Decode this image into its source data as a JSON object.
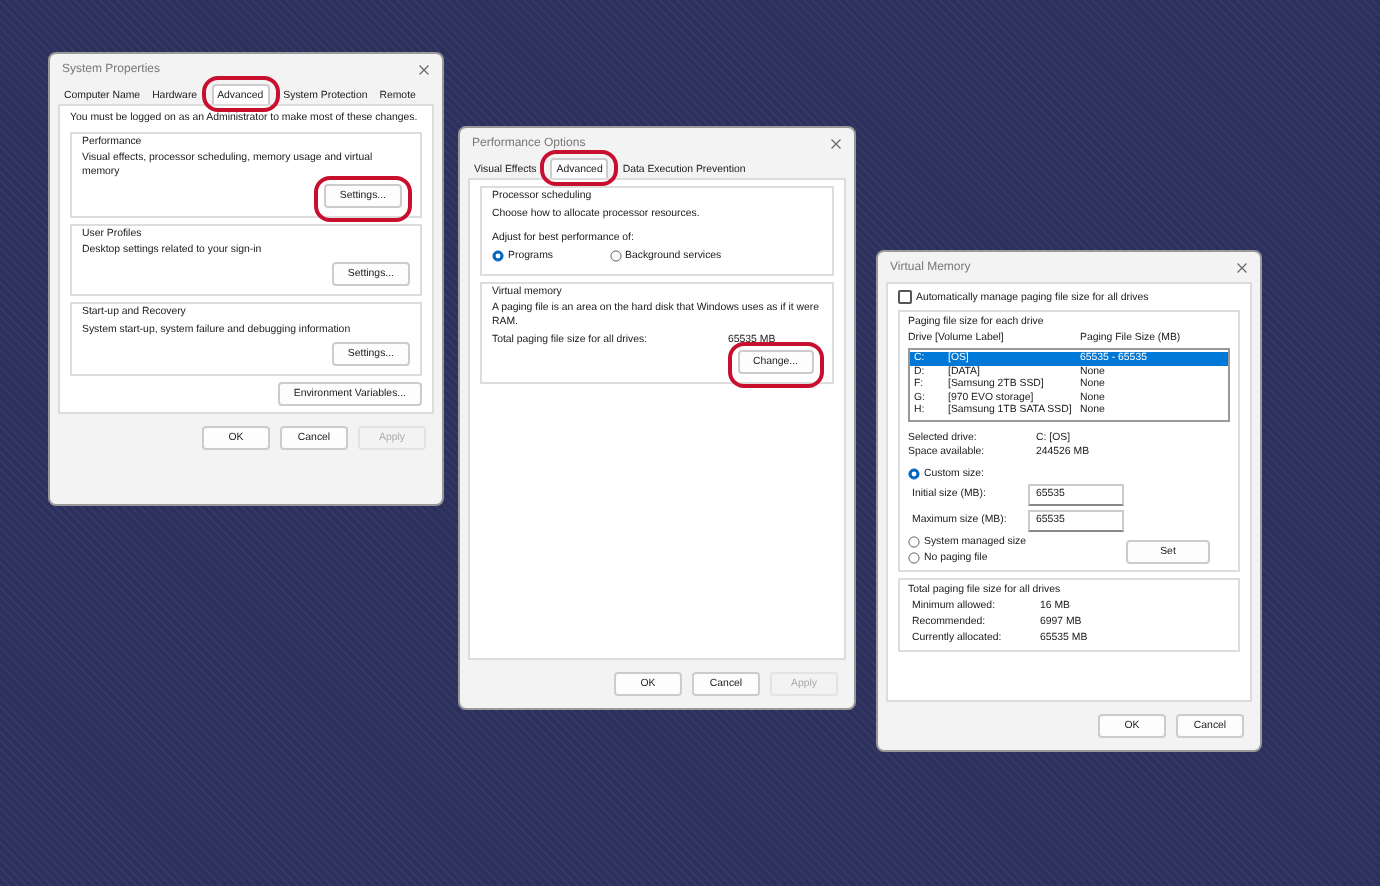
{
  "system_properties": {
    "title": "System Properties",
    "tabs": [
      {
        "label": "Computer Name",
        "selected": false,
        "highlighted": false
      },
      {
        "label": "Hardware",
        "selected": false,
        "highlighted": false
      },
      {
        "label": "Advanced",
        "selected": true,
        "highlighted": true
      },
      {
        "label": "System Protection",
        "selected": false,
        "highlighted": false
      },
      {
        "label": "Remote",
        "selected": false,
        "highlighted": false
      }
    ],
    "notice": "You must be logged on as an Administrator to make most of these changes.",
    "groups": [
      {
        "title": "Performance",
        "description": "Visual effects, processor scheduling, memory usage and virtual memory",
        "button": "Settings...",
        "button_highlighted": true
      },
      {
        "title": "User Profiles",
        "description": "Desktop settings related to your sign-in",
        "button": "Settings...",
        "button_highlighted": false
      },
      {
        "title": "Start-up and Recovery",
        "description": "System start-up, system failure and debugging information",
        "button": "Settings...",
        "button_highlighted": false
      }
    ],
    "env_button": "Environment Variables...",
    "buttons": [
      {
        "label": "OK",
        "disabled": false
      },
      {
        "label": "Cancel",
        "disabled": false
      },
      {
        "label": "Apply",
        "disabled": true
      }
    ]
  },
  "performance_options": {
    "title": "Performance Options",
    "tabs": [
      {
        "label": "Visual Effects",
        "selected": false,
        "highlighted": false
      },
      {
        "label": "Advanced",
        "selected": true,
        "highlighted": true
      },
      {
        "label": "Data Execution Prevention",
        "selected": false,
        "highlighted": false
      }
    ],
    "processor_scheduling": {
      "title": "Processor scheduling",
      "description": "Choose how to allocate processor resources.",
      "adjust_label": "Adjust for best performance of:",
      "options": [
        {
          "label": "Programs",
          "selected": true
        },
        {
          "label": "Background services",
          "selected": false
        }
      ]
    },
    "virtual_memory": {
      "title": "Virtual memory",
      "description": "A paging file is an area on the hard disk that Windows uses as if it were RAM.",
      "total_label": "Total paging file size for all drives:",
      "total_value": "65535 MB",
      "button": "Change...",
      "button_highlighted": true
    },
    "buttons": [
      {
        "label": "OK",
        "disabled": false
      },
      {
        "label": "Cancel",
        "disabled": false
      },
      {
        "label": "Apply",
        "disabled": true
      }
    ]
  },
  "virtual_memory": {
    "title": "Virtual Memory",
    "auto_manage": {
      "label": "Automatically manage paging file size for all drives",
      "checked": false
    },
    "list_title": "Paging file size for each drive",
    "columns": [
      "Drive  [Volume Label]",
      "Paging File Size (MB)"
    ],
    "drives": [
      {
        "drive": "C:",
        "label": "[OS]",
        "size": "65535 - 65535",
        "selected": true
      },
      {
        "drive": "D:",
        "label": "[DATA]",
        "size": "None",
        "selected": false
      },
      {
        "drive": "F:",
        "label": "[Samsung 2TB SSD]",
        "size": "None",
        "selected": false
      },
      {
        "drive": "G:",
        "label": "[970 EVO storage]",
        "size": "None",
        "selected": false
      },
      {
        "drive": "H:",
        "label": "[Samsung 1TB SATA SSD]",
        "size": "None",
        "selected": false
      }
    ],
    "info": [
      {
        "label": "Selected drive:",
        "value": "C:  [OS]"
      },
      {
        "label": "Space available:",
        "value": "244526 MB"
      }
    ],
    "size_options": [
      {
        "label": "Custom size:",
        "selected": true
      },
      {
        "label": "System managed size",
        "selected": false
      },
      {
        "label": "No paging file",
        "selected": false
      }
    ],
    "fields": [
      {
        "label": "Initial size (MB):",
        "value": "65535"
      },
      {
        "label": "Maximum size (MB):",
        "value": "65535"
      }
    ],
    "set_button": "Set",
    "totals": {
      "title": "Total paging file size for all drives",
      "rows": [
        {
          "label": "Minimum allowed:",
          "value": "16 MB"
        },
        {
          "label": "Recommended:",
          "value": "6997 MB"
        },
        {
          "label": "Currently allocated:",
          "value": "65535 MB"
        }
      ]
    },
    "buttons": [
      {
        "label": "OK",
        "disabled": false
      },
      {
        "label": "Cancel",
        "disabled": false
      }
    ]
  }
}
